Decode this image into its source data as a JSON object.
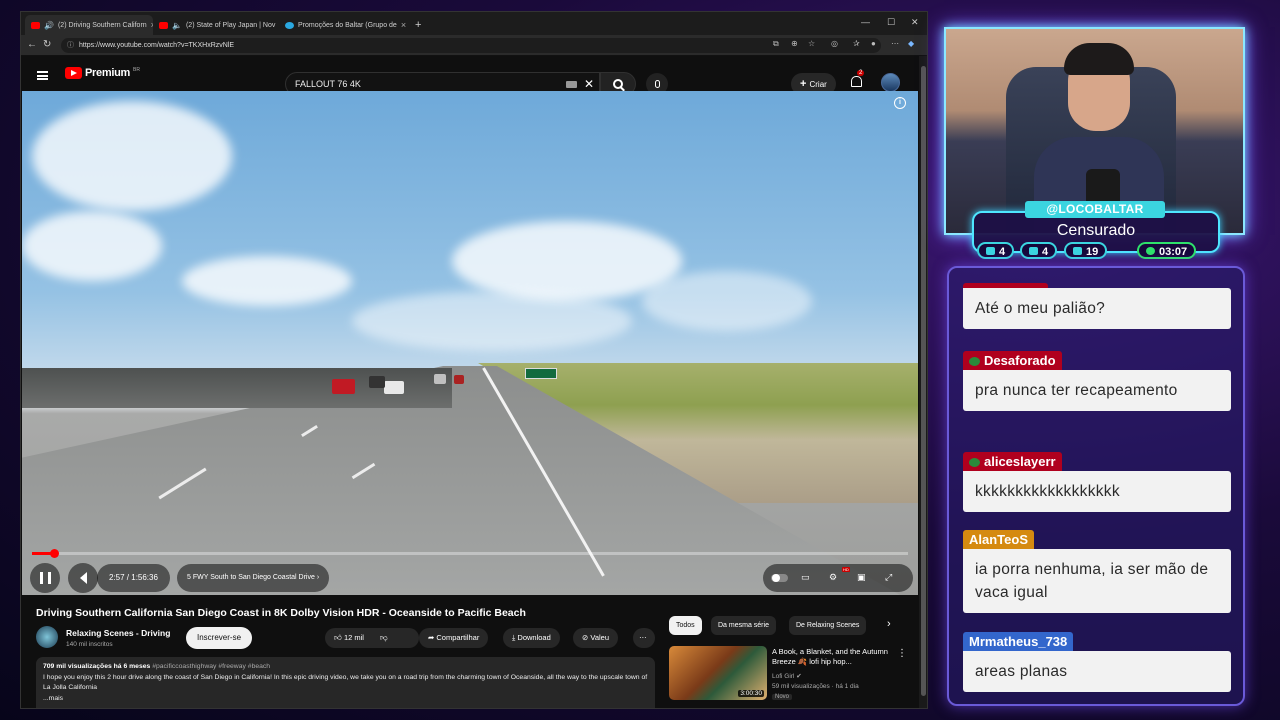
{
  "browser": {
    "tabs": [
      {
        "label": "(2) Driving Southern Californ",
        "active": true
      },
      {
        "label": "(2) State of Play Japan | Nov",
        "active": false
      },
      {
        "label": "Promoções do Baltar (Grupo de",
        "active": false
      }
    ],
    "url": "https://www.youtube.com/watch?v=TKXHxRzvNlE"
  },
  "youtube": {
    "brand": "Premium",
    "region": "BR",
    "search_value": "FALLOUT 76 4K",
    "create_label": "Criar",
    "notif_count": "2"
  },
  "player": {
    "time": "2:57 / 1:56:36",
    "chapter": "5 FWY South to San Diego Coastal Drive",
    "progress_fraction": 0.025,
    "hd_badge": "HD"
  },
  "video": {
    "title": "Driving Southern California San Diego Coast in 8K Dolby Vision HDR - Oceanside to Pacific Beach",
    "channel": "Relaxing Scenes - Driving",
    "subscribers": "140 mil inscritos",
    "subscribe_label": "Inscrever-se",
    "likes": "12 mil",
    "share_label": "Compartilhar",
    "download_label": "Download",
    "thanks_label": "Valeu",
    "views_line": "709 mil visualizações há 6 meses",
    "hashtags": "#pacificcoasthighway #freeway #beach",
    "description": "I hope you enjoy this 2 hour drive along the coast of San Diego in California! In this epic driving video, we take you on a road trip from the charming town of Oceanside, all the way to the upscale town of La Jolla California",
    "more_label": "...mais"
  },
  "related": {
    "chips": [
      "Todos",
      "Da mesma série",
      "De Relaxing Scenes"
    ],
    "item": {
      "title": "A Book, a Blanket, and the Autumn Breeze 🍂 lofi hip hop...",
      "channel": "Lofi Girl",
      "meta": "59 mil visualizações · há 1 dia",
      "badge": "Novo",
      "duration": "3:00:30"
    }
  },
  "stream": {
    "handle": "@LOCOBALTAR",
    "status": "Censurado",
    "stats": [
      "4",
      "4",
      "19"
    ],
    "timer": "03:07",
    "chat": [
      {
        "user": "",
        "text": "Até o meu palião?",
        "color": "#b0001e"
      },
      {
        "user": "Desaforado",
        "text": "pra nunca ter recapeamento",
        "color": "#b0001e"
      },
      {
        "user": "aliceslayerr",
        "text": "kkkkkkkkkkkkkkkkkk",
        "color": "#b0001e"
      },
      {
        "user": "AlanTeoS",
        "text": "ia porra nenhuma, ia ser mão de vaca igual",
        "color": "#d58a10"
      },
      {
        "user": "Mrmatheus_738",
        "text": "areas planas",
        "color": "#3366cc"
      }
    ]
  }
}
